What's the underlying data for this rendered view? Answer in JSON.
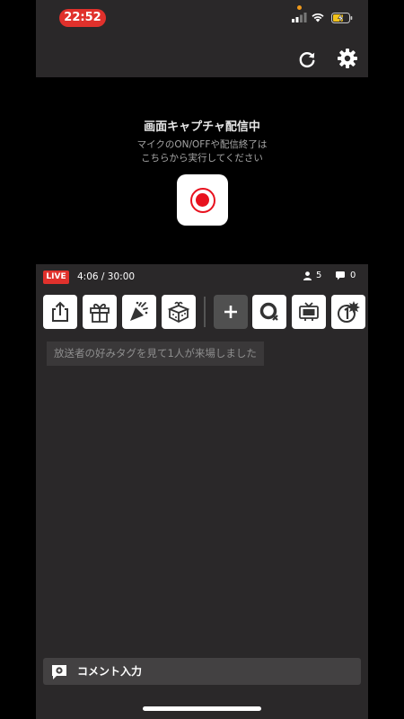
{
  "status_bar": {
    "time": "22:52",
    "signal_icon": "cellular-signal-icon",
    "wifi_icon": "wifi-icon",
    "battery_icon": "battery-charging-icon"
  },
  "toolbar": {
    "refresh_icon": "refresh-icon",
    "settings_icon": "gear-icon"
  },
  "capture": {
    "title": "画面キャプチャ配信中",
    "subtitle_line1": "マイクのON/OFFや配信終了は",
    "subtitle_line2": "こちらから実行してください",
    "record_icon": "record-icon"
  },
  "live": {
    "badge": "LIVE",
    "elapsed": "4:06 / 30:00",
    "viewers": "5",
    "comments": "0"
  },
  "tools": [
    {
      "icon": "share-icon"
    },
    {
      "icon": "gift-icon"
    },
    {
      "icon": "party-popper-icon"
    },
    {
      "icon": "gift-box-icon"
    },
    {
      "icon": "plus-icon"
    },
    {
      "icon": "quiz-icon"
    },
    {
      "icon": "tv-icon"
    },
    {
      "icon": "number-one-badge-icon"
    }
  ],
  "notice": "放送者の好みタグを見て1人が来場しました",
  "comment_input": {
    "label": "コメント入力"
  },
  "colors": {
    "accent_red": "#e0312c",
    "record_red": "#e8111e",
    "panel_bg": "#2a2829"
  }
}
